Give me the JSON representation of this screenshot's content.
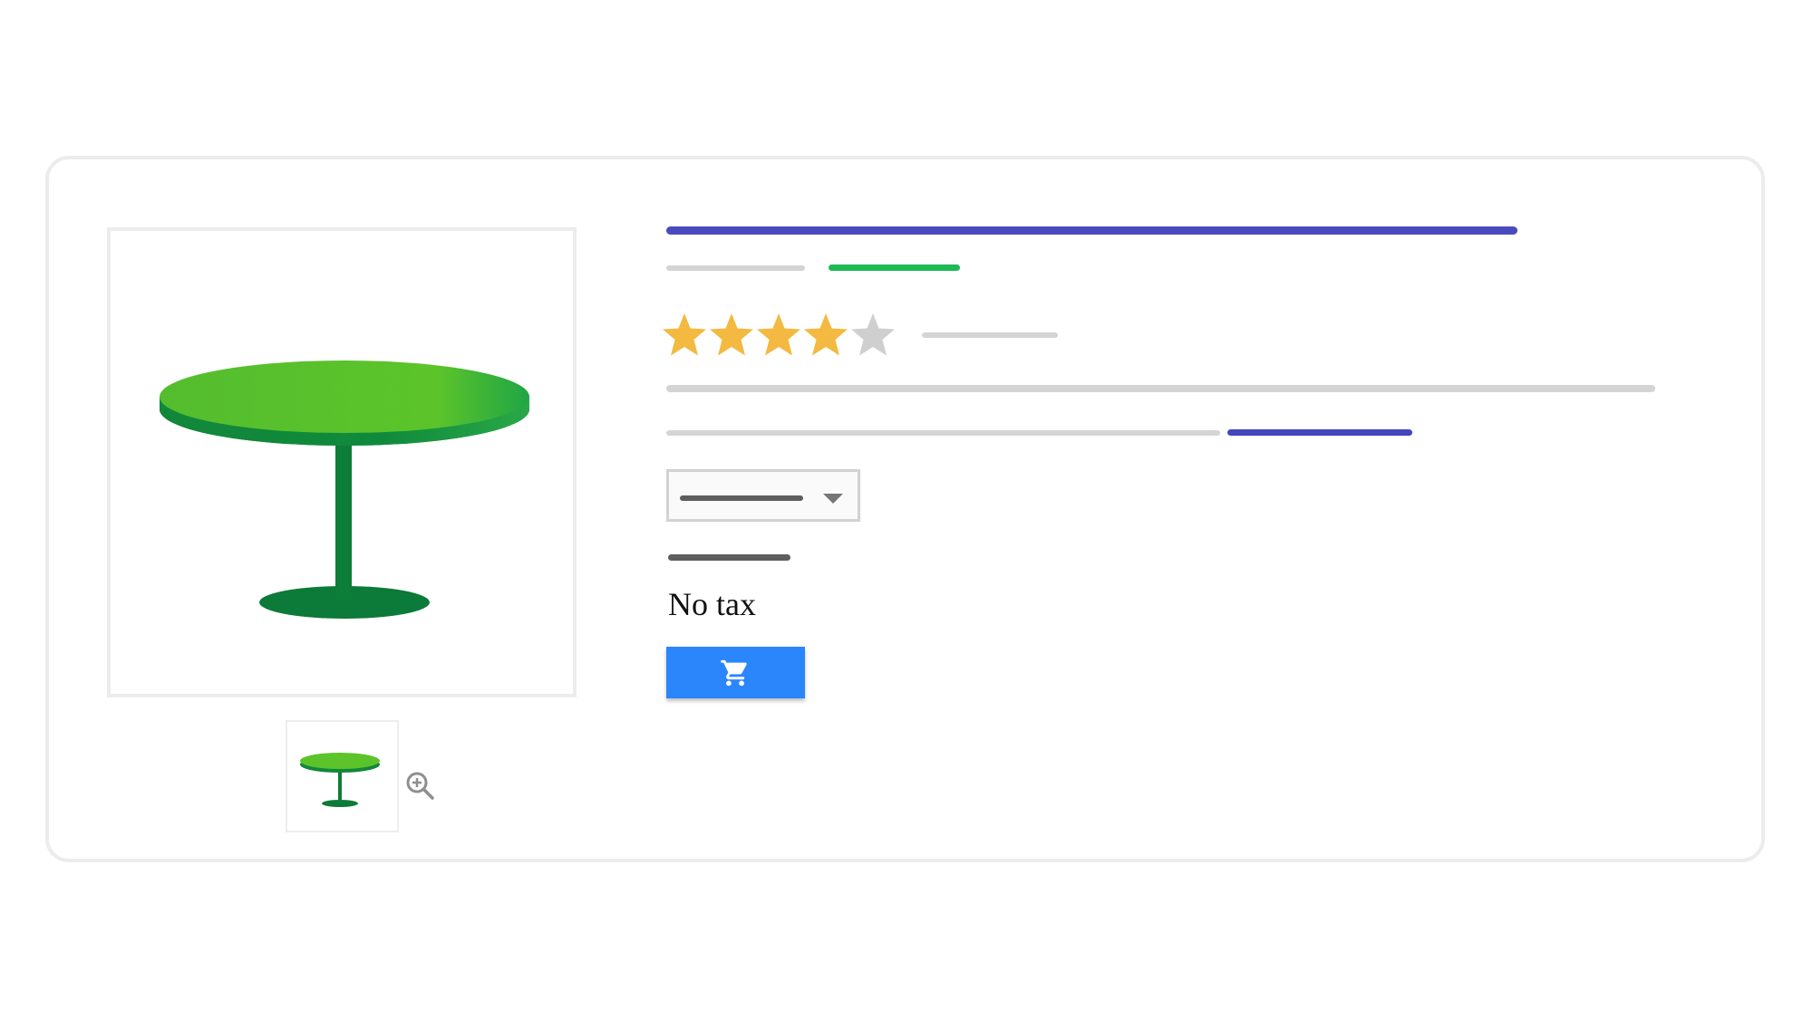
{
  "product": {
    "tax_note": "No tax",
    "rating": 4,
    "rating_max": 5,
    "image_icon": "round-pedestal-table-image",
    "thumbnail_icon": "round-pedestal-table-thumbnail"
  },
  "gallery": {
    "zoom_icon": "zoom-in-icon"
  },
  "cart": {
    "icon": "shopping-cart-icon"
  },
  "colors": {
    "title": "#4a4abf",
    "placeholder": "#d4d4d4",
    "accent_green": "#1db954",
    "link": "#4545be",
    "price": "#5e5e5e",
    "star_filled": "#f3b940",
    "star_empty": "#cfcfcf",
    "button": "#2b86fc",
    "table_top": "#5cc42a",
    "table_dark": "#0e7c3a"
  }
}
